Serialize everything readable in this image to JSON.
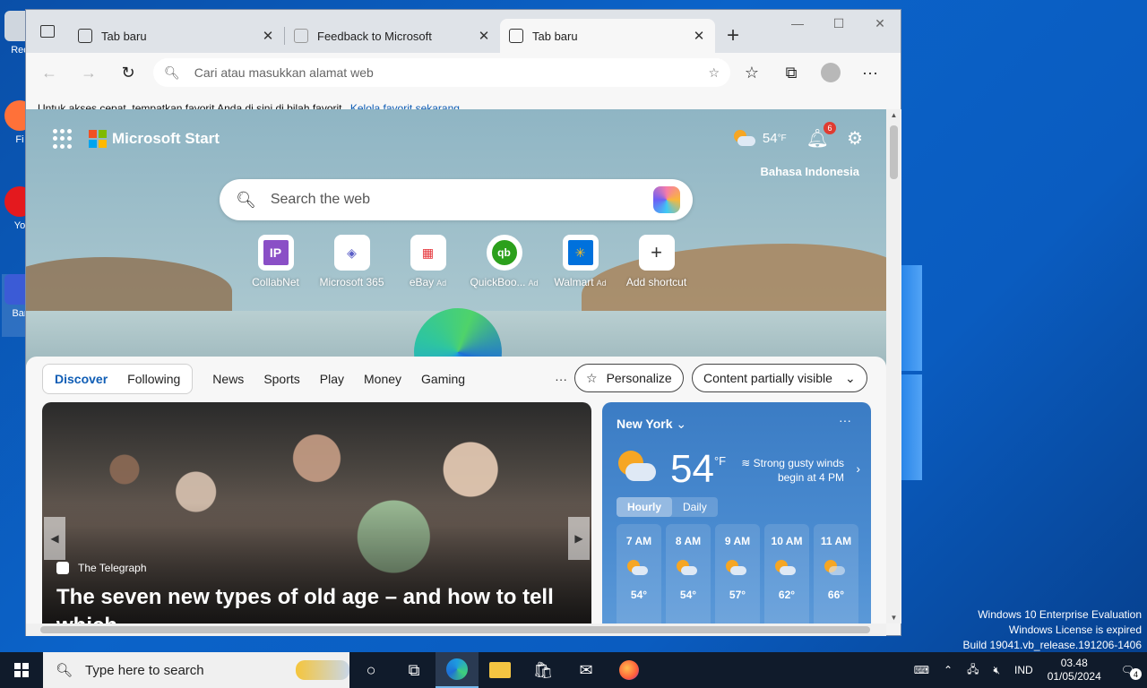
{
  "desktop": {
    "icons": [
      {
        "label": "Rec"
      },
      {
        "label": "Fi"
      },
      {
        "label": "Yo"
      },
      {
        "label": "Bar"
      }
    ],
    "watermark": {
      "line1": "Windows 10 Enterprise Evaluation",
      "line2": "Windows License is expired",
      "line3": "Build 19041.vb_release.191206-1406"
    }
  },
  "browser": {
    "tabs": [
      {
        "title": "Tab baru",
        "close": "✕"
      },
      {
        "title": "Feedback to Microsoft",
        "close": "✕"
      },
      {
        "title": "Tab baru",
        "close": "✕"
      }
    ],
    "new_tab": "+",
    "address": {
      "placeholder": "Cari atau masukkan alamat web"
    },
    "favbar": {
      "message": "Untuk akses cepat, tempatkan favorit Anda di sini di bilah favorit.",
      "link": "Kelola favorit sekarang"
    }
  },
  "start_page": {
    "brand": "Microsoft Start",
    "weather_temp": "54",
    "weather_unit": "°F",
    "notifications_count": "6",
    "language": "Bahasa Indonesia",
    "search_placeholder": "Search the web",
    "shortcuts": [
      {
        "name": "CollabNet",
        "tile": "IP",
        "ad": ""
      },
      {
        "name": "Microsoft 365",
        "tile": "◈",
        "ad": ""
      },
      {
        "name": "eBay",
        "tile": "▦",
        "ad": "Ad"
      },
      {
        "name": "QuickBoo...",
        "tile": "qb",
        "ad": "Ad"
      },
      {
        "name": "Walmart",
        "tile": "✳",
        "ad": "Ad"
      },
      {
        "name": "Add shortcut",
        "tile": "+",
        "ad": ""
      }
    ],
    "feed_tabs": {
      "discover": "Discover",
      "following": "Following",
      "items": [
        "News",
        "Sports",
        "Play",
        "Money",
        "Gaming"
      ],
      "more": "···"
    },
    "personalize": "Personalize",
    "content_visibility": "Content partially visible",
    "hero": {
      "source": "The Telegraph",
      "headline": "The seven new types of old age – and how to tell which..."
    },
    "weather_card": {
      "city": "New York",
      "temp": "54",
      "unit": "°F",
      "alert_line1": "Strong gusty winds",
      "alert_line2": "begin at 4 PM",
      "tab_hourly": "Hourly",
      "tab_daily": "Daily",
      "more": "···",
      "hours": [
        {
          "time": "7 AM",
          "temp": "54°"
        },
        {
          "time": "8 AM",
          "temp": "54°"
        },
        {
          "time": "9 AM",
          "temp": "57°"
        },
        {
          "time": "10 AM",
          "temp": "62°"
        },
        {
          "time": "11 AM",
          "temp": "66°"
        }
      ]
    }
  },
  "taskbar": {
    "search_placeholder": "Type here to search",
    "language": "IND",
    "time": "03.48",
    "date": "01/05/2024",
    "notification_count": "4"
  }
}
